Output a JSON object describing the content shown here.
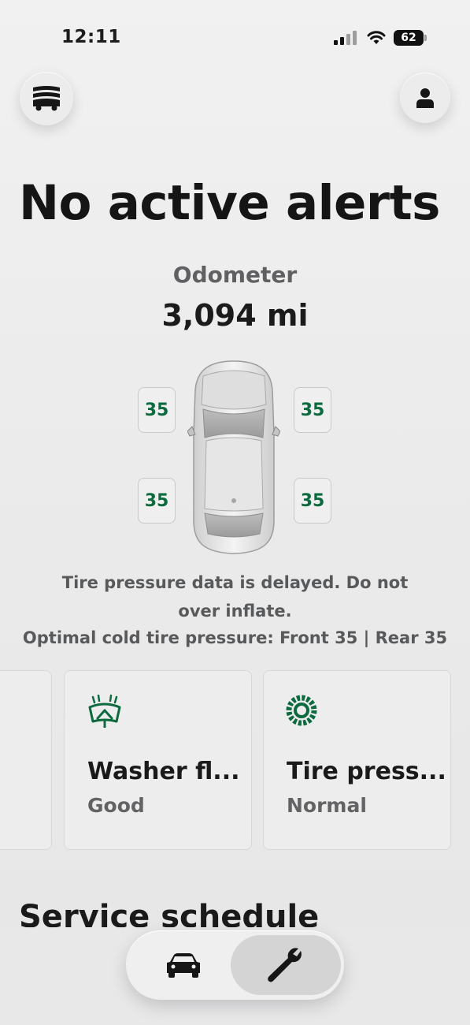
{
  "status_bar": {
    "time": "12:11",
    "battery": "62"
  },
  "header": {
    "garage_icon": "garage-icon",
    "profile_icon": "person-icon"
  },
  "alerts": {
    "headline": "No active alerts"
  },
  "odometer": {
    "label": "Odometer",
    "value": "3,094 mi"
  },
  "tires": {
    "front_left": "35",
    "front_right": "35",
    "rear_left": "35",
    "rear_right": "35"
  },
  "tire_notice": {
    "line1": "Tire pressure data is delayed. Do not",
    "line2": "over inflate.",
    "line3": "Optimal cold tire pressure: Front 35 | Rear 35"
  },
  "cards": [
    {
      "title": "Washer fl...",
      "status": "Good",
      "icon": "windshield-washer-icon"
    },
    {
      "title": "Tire press...",
      "status": "Normal",
      "icon": "tire-icon"
    }
  ],
  "service": {
    "title": "Service schedule"
  },
  "tabs": [
    {
      "icon": "car-icon",
      "selected": false
    },
    {
      "icon": "wrench-icon",
      "selected": true
    }
  ],
  "colors": {
    "accent": "#0c6a3f",
    "text": "#1b1b1b",
    "muted": "#606062"
  }
}
